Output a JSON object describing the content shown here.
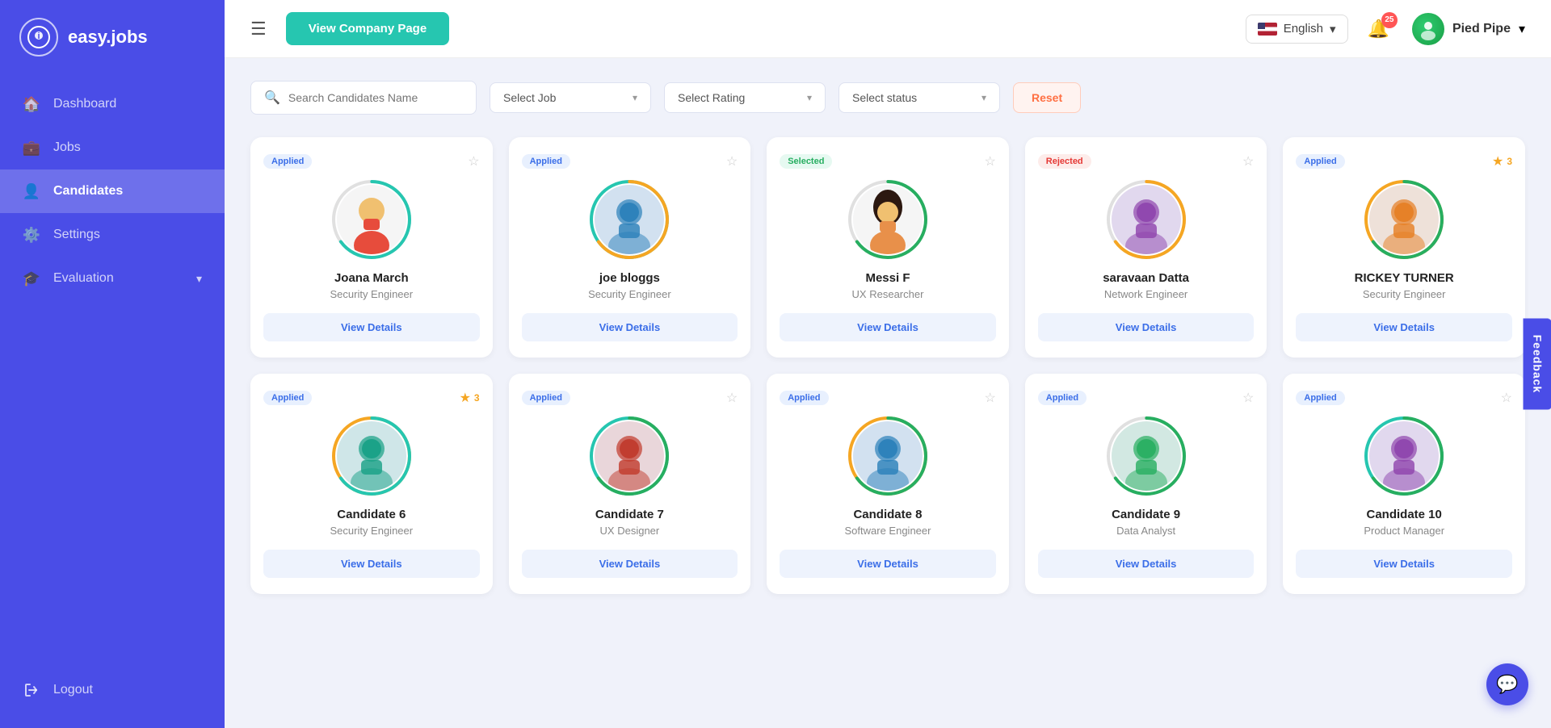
{
  "app": {
    "name": "easy.jobs",
    "logo_char": "@"
  },
  "sidebar": {
    "items": [
      {
        "id": "dashboard",
        "label": "Dashboard",
        "icon": "🏠",
        "active": false
      },
      {
        "id": "jobs",
        "label": "Jobs",
        "icon": "💼",
        "active": false
      },
      {
        "id": "candidates",
        "label": "Candidates",
        "icon": "👤",
        "active": true
      },
      {
        "id": "settings",
        "label": "Settings",
        "icon": "⚙️",
        "active": false
      },
      {
        "id": "evaluation",
        "label": "Evaluation",
        "icon": "🎓",
        "active": false,
        "has_arrow": true
      }
    ],
    "logout_label": "Logout",
    "logout_icon": "🚪"
  },
  "header": {
    "menu_icon": "☰",
    "view_company_label": "View Company Page",
    "language": "English",
    "language_arrow": "▾",
    "notification_count": "25",
    "user_name": "Pied Pipe",
    "user_arrow": "▾"
  },
  "filters": {
    "search_placeholder": "Search Candidates Name",
    "select_job_label": "Select Job",
    "select_rating_label": "Select Rating",
    "select_status_label": "Select status",
    "reset_label": "Reset"
  },
  "candidates": [
    {
      "name": "Joana March",
      "role": "Security Engineer",
      "status": "Applied",
      "status_type": "applied",
      "rating": 0,
      "ring_color1": "#26c6b0",
      "ring_color2": "#e0e0e0",
      "has_photo": false,
      "gender": "male"
    },
    {
      "name": "joe bloggs",
      "role": "Security Engineer",
      "status": "Applied",
      "status_type": "applied",
      "rating": 0,
      "ring_color1": "#f5a623",
      "ring_color2": "#26c6b0",
      "has_photo": true,
      "photo_desc": "landscape photo"
    },
    {
      "name": "Messi F",
      "role": "UX Researcher",
      "status": "Selected",
      "status_type": "selected",
      "rating": 0,
      "ring_color1": "#27ae60",
      "ring_color2": "#e0e0e0",
      "has_photo": false,
      "gender": "female"
    },
    {
      "name": "saravaan Datta",
      "role": "Network Engineer",
      "status": "Rejected",
      "status_type": "rejected",
      "rating": 0,
      "ring_color1": "#f5a623",
      "ring_color2": "#e0e0e0",
      "has_photo": true,
      "photo_desc": "male with glasses"
    },
    {
      "name": "RICKEY TURNER",
      "role": "Security Engineer",
      "status": "Applied",
      "status_type": "applied",
      "rating": 3,
      "ring_color1": "#27ae60",
      "ring_color2": "#f5a623",
      "has_photo": true,
      "photo_desc": "male in suit"
    },
    {
      "name": "Candidate 6",
      "role": "Security Engineer",
      "status": "Applied",
      "status_type": "applied",
      "rating": 3,
      "ring_color1": "#26c6b0",
      "ring_color2": "#f5a623",
      "has_photo": true,
      "photo_desc": "bearded male"
    },
    {
      "name": "Candidate 7",
      "role": "UX Designer",
      "status": "Applied",
      "status_type": "applied",
      "rating": 0,
      "ring_color1": "#27ae60",
      "ring_color2": "#26c6b0",
      "has_photo": true,
      "photo_desc": "female thinking"
    },
    {
      "name": "Candidate 8",
      "role": "Software Engineer",
      "status": "Applied",
      "status_type": "applied",
      "rating": 0,
      "ring_color1": "#27ae60",
      "ring_color2": "#f5a623",
      "has_photo": true,
      "photo_desc": "male with glasses arms crossed"
    },
    {
      "name": "Candidate 9",
      "role": "Data Analyst",
      "status": "Applied",
      "status_type": "applied",
      "rating": 0,
      "ring_color1": "#27ae60",
      "ring_color2": "#e0e0e0",
      "has_photo": true,
      "photo_desc": "male with laptop"
    },
    {
      "name": "Candidate 10",
      "role": "Product Manager",
      "status": "Applied",
      "status_type": "applied",
      "rating": 0,
      "ring_color1": "#27ae60",
      "ring_color2": "#26c6b0",
      "has_photo": true,
      "photo_desc": "male in white shirt"
    }
  ],
  "view_details_label": "View Details",
  "feedback_label": "Feedback"
}
